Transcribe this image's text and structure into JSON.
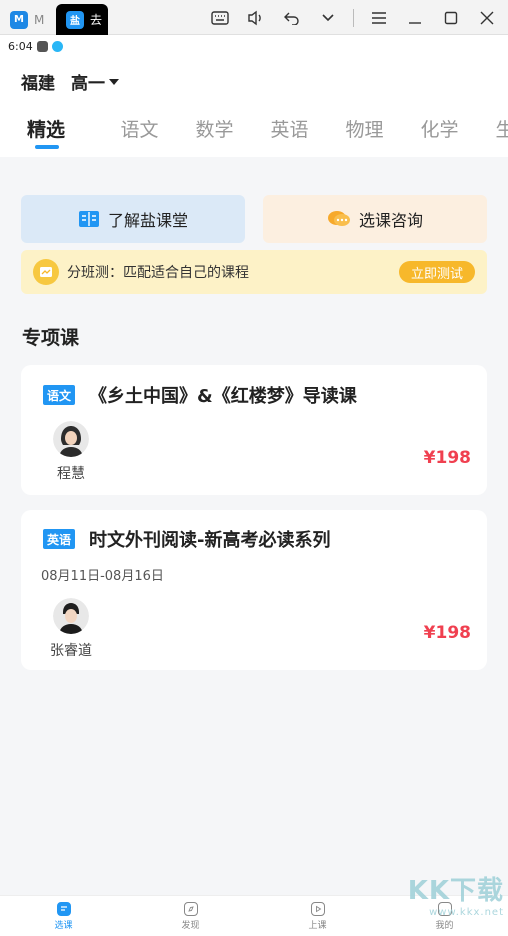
{
  "window": {
    "tabs": [
      {
        "icon": "M",
        "label": "M"
      },
      {
        "icon": "盐",
        "label": "去"
      }
    ]
  },
  "status": {
    "time": "6:04"
  },
  "header": {
    "region": "福建",
    "grade": "高一",
    "subjects": [
      "精选",
      "语文",
      "数学",
      "英语",
      "物理",
      "化学",
      "生物"
    ]
  },
  "quick_actions": {
    "about_label": "了解盐课堂",
    "consult_label": "选课咨询"
  },
  "placement": {
    "text": "分班测：匹配适合自己的课程",
    "button": "立即测试"
  },
  "section": {
    "title": "专项课"
  },
  "courses": [
    {
      "tag": "语文",
      "title": "《乡土中国》&《红楼梦》导读课",
      "date": "",
      "teacher": "程慧",
      "price": "¥198"
    },
    {
      "tag": "英语",
      "title": "时文外刊阅读-新高考必读系列",
      "date": "08月11日-08月16日",
      "teacher": "张睿道",
      "price": "¥198"
    }
  ],
  "bottom_nav": [
    "选课",
    "发现",
    "上课",
    "我的"
  ],
  "watermark": {
    "main": "KK下载",
    "url": "www.kkx.net"
  },
  "colors": {
    "accent": "#2196f3",
    "price": "#f04050",
    "test_button": "#f7b82b"
  }
}
